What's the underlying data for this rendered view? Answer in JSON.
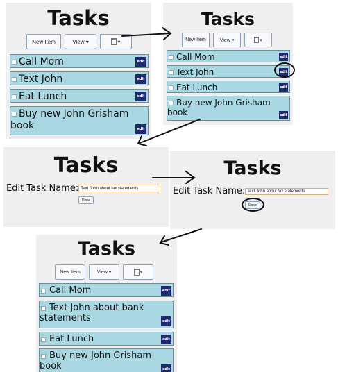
{
  "panel1": {
    "title": "Tasks",
    "new_item": "New Item",
    "view": "View ▾",
    "trash_chevron": "▾",
    "trash_icon": "trash-icon",
    "tasks": [
      "Call Mom",
      "Text John",
      "Eat Lunch",
      "Buy new John Grisham book"
    ],
    "edit_label": "edit"
  },
  "panel2": {
    "title": "Tasks",
    "new_item": "New Item",
    "view": "View ▾",
    "trash_chevron": "▾",
    "tasks": [
      "Call Mom",
      "Text John",
      "Eat Lunch",
      "Buy new John Grisham book"
    ],
    "edit_label": "edit"
  },
  "panel3": {
    "title": "Tasks",
    "edit_label": "Edit Task Name:",
    "input_value": "Text John about tax statements",
    "done": "Done"
  },
  "panel4": {
    "title": "Tasks",
    "edit_label": "Edit Task Name:",
    "input_value": "Text John about tax statements",
    "done": "Done"
  },
  "panel5": {
    "title": "Tasks",
    "new_item": "New Item",
    "view": "View ▾",
    "trash_chevron": "▾",
    "tasks": [
      "Call Mom",
      "Text John about bank statements",
      "Eat Lunch",
      "Buy new John Grisham book"
    ],
    "edit_label": "edit"
  },
  "colors": {
    "task_bg": "#a9d8e3",
    "edit_bg": "#1e2a6b",
    "panel_bg": "#efefef"
  }
}
